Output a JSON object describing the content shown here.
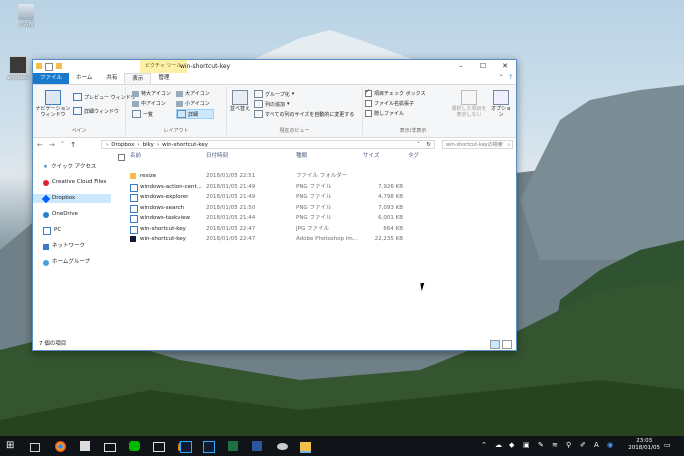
{
  "desktop": {
    "icons": [
      {
        "label": "ごみ箱",
        "name": "recycle-bin"
      },
      {
        "label": "windows",
        "name": "windows-shortcut"
      }
    ]
  },
  "window": {
    "title": "win-shortcut-key",
    "context_tab": "ピクチャ ツール",
    "tabs": {
      "file": "ファイル",
      "home": "ホーム",
      "share": "共有",
      "view": "表示",
      "manage": "管理"
    },
    "ribbon": {
      "pane": {
        "nav_pane": "ナビゲーション\nウィンドウ",
        "preview": "プレビュー ウィンドウ",
        "details": "詳細ウィンドウ",
        "label": "ペイン"
      },
      "layout": {
        "xl_icons": "特大アイコン",
        "l_icons": "大アイコン",
        "m_icons": "中アイコン",
        "s_icons": "小アイコン",
        "list": "一覧",
        "details": "詳細",
        "label": "レイアウト"
      },
      "current_view": {
        "sort": "並べ替え",
        "group": "グループ化",
        "add_columns": "列の追加",
        "fit_columns": "すべての列のサイズを自動的に変更する",
        "label": "現在のビュー"
      },
      "show_hide": {
        "item_checkbox": "項目チェック ボックス",
        "extensions": "ファイル名拡張子",
        "hidden": "隠しファイル",
        "hide_selected": "選択した項目を\n表示しない",
        "options": "オプション",
        "label": "表示/非表示"
      }
    },
    "address": [
      "Dropbox",
      "blky",
      "win-shortcut-key"
    ],
    "search_placeholder": "win-shortcut-keyの検索",
    "nav_pane": {
      "items": [
        {
          "label": "クイック アクセス",
          "icon": "star-icon"
        },
        {
          "label": "Creative Cloud Files",
          "icon": "creative-cloud-icon"
        },
        {
          "label": "Dropbox",
          "icon": "dropbox-icon",
          "selected": true
        },
        {
          "label": "OneDrive",
          "icon": "onedrive-icon"
        },
        {
          "label": "PC",
          "icon": "pc-icon"
        },
        {
          "label": "ネットワーク",
          "icon": "network-icon"
        },
        {
          "label": "ホームグループ",
          "icon": "homegroup-icon"
        }
      ]
    },
    "columns": {
      "name": "名前",
      "date": "日付時刻",
      "type": "種類",
      "size": "サイズ",
      "tag": "タグ"
    },
    "files": [
      {
        "name": "resize",
        "date": "2018/01/05 22:51",
        "type": "ファイル フォルダー",
        "size": "",
        "icon": "folder-icon"
      },
      {
        "name": "windows-action-cent...",
        "date": "2018/01/05 21:49",
        "type": "PNG ファイル",
        "size": "7,926 KB",
        "icon": "image-file-icon"
      },
      {
        "name": "windows-explorer",
        "date": "2018/01/05 21:49",
        "type": "PNG ファイル",
        "size": "4,798 KB",
        "icon": "image-file-icon"
      },
      {
        "name": "windows-search",
        "date": "2018/01/05 21:50",
        "type": "PNG ファイル",
        "size": "7,093 KB",
        "icon": "image-file-icon"
      },
      {
        "name": "windows-taskview",
        "date": "2018/01/05 21:44",
        "type": "PNG ファイル",
        "size": "6,001 KB",
        "icon": "image-file-icon"
      },
      {
        "name": "win-shortcut-key",
        "date": "2018/01/05 22:47",
        "type": "JPG ファイル",
        "size": "664 KB",
        "icon": "image-file-icon"
      },
      {
        "name": "win-shortcut-key",
        "date": "2018/01/05 22:47",
        "type": "Adobe Photoshop Im...",
        "size": "22,235 KB",
        "icon": "photoshop-file-icon"
      }
    ],
    "status": "7 個の項目"
  },
  "taskbar": {
    "time": "23:03",
    "date": "2018/01/05",
    "colors": {
      "accent": "#1979ca",
      "taskbar": "#101418"
    }
  }
}
